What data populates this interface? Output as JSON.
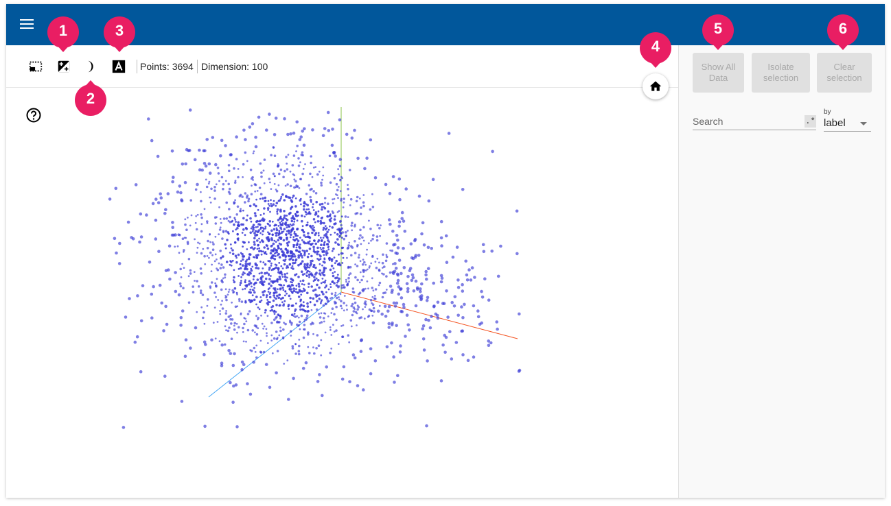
{
  "toolbar": {
    "icons": [
      "bounding-box-select-icon",
      "night-mode-toggle-icon",
      "crescent-moon-icon",
      "label-text-icon"
    ],
    "points_label": "Points: 3694",
    "dimension_label": "Dimension: 100"
  },
  "side_panel": {
    "show_all_data": [
      "Show All",
      "Data"
    ],
    "isolate_selection": [
      "Isolate",
      "selection"
    ],
    "clear_selection": [
      "Clear",
      "selection"
    ],
    "search_placeholder": "Search",
    "regex_toggle": ".*",
    "by_label": "by",
    "by_value": "label"
  },
  "annotations": [
    "1",
    "2",
    "3",
    "4",
    "5",
    "6"
  ],
  "colors": {
    "header": "#01579b",
    "marker": "#e91e63",
    "point": "#3b3bd6",
    "axis_x": "#f4511e",
    "axis_y": "#8bc34a",
    "axis_z": "#42a5f5"
  },
  "chart_data": {
    "type": "scatter",
    "note_points_total": "3694",
    "axes": [
      "x",
      "y",
      "z"
    ]
  }
}
